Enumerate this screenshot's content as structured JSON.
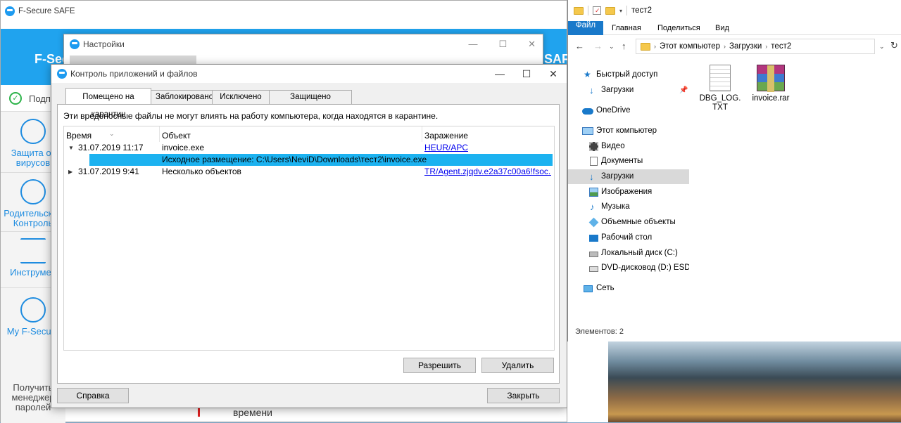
{
  "fsafe": {
    "title": "F-Secure SAFE",
    "brand_left": "F-Sec",
    "brand_right": "SAFE",
    "status_text": "Подпи",
    "sidebar": [
      {
        "label": "Защита от вирусов"
      },
      {
        "label": "Родительский Контроль"
      },
      {
        "label": "Инструмен"
      },
      {
        "label": "My F-Secure"
      }
    ],
    "sidebar_bottom": "Получить менеджер паролей",
    "bottom_word": "времени"
  },
  "settings": {
    "title": "Настройки"
  },
  "dialog": {
    "title": "Контроль приложений и файлов",
    "tabs": [
      "Помещено на карантин",
      "Заблокировано",
      "Исключено",
      "Защищено"
    ],
    "description": "Эти вредоносные файлы не могут влиять на работу компьютера, когда находятся в карантине.",
    "columns": [
      "Время",
      "Объект",
      "Заражение"
    ],
    "rows": [
      {
        "time": "31.07.2019 11:17",
        "object": "invoice.exe",
        "infection": "HEUR/APC"
      },
      {
        "detail": "Исходное размещение: C:\\Users\\NeviD\\Downloads\\тест2\\invoice.exe"
      },
      {
        "time": "31.07.2019 9:41",
        "object": "Несколько объектов",
        "infection": "TR/Agent.zjqdv.e2a37c00a6!fsoc..."
      }
    ],
    "buttons": {
      "allow": "Разрешить",
      "delete": "Удалить",
      "help": "Справка",
      "close": "Закрыть"
    }
  },
  "explorer": {
    "title": "тест2",
    "ribbon": [
      "Файл",
      "Главная",
      "Поделиться",
      "Вид"
    ],
    "breadcrumb": [
      "Этот компьютер",
      "Загрузки",
      "тест2"
    ],
    "nav": [
      {
        "label": "Быстрый доступ",
        "icon": "star-icon"
      },
      {
        "label": "Загрузки",
        "icon": "download-icon"
      },
      {
        "label": "OneDrive",
        "icon": "cloud-icon"
      },
      {
        "label": "Этот компьютер",
        "icon": "computer-icon"
      },
      {
        "label": "Видео",
        "icon": "video-icon"
      },
      {
        "label": "Документы",
        "icon": "document-icon"
      },
      {
        "label": "Загрузки",
        "icon": "download-icon"
      },
      {
        "label": "Изображения",
        "icon": "image-icon"
      },
      {
        "label": "Музыка",
        "icon": "music-icon"
      },
      {
        "label": "Объемные объекты",
        "icon": "cube-icon"
      },
      {
        "label": "Рабочий стол",
        "icon": "desktop-icon"
      },
      {
        "label": "Локальный диск (C:)",
        "icon": "drive-icon"
      },
      {
        "label": "DVD-дисковод (D:) ESD-IS",
        "icon": "dvd-icon"
      },
      {
        "label": "Сеть",
        "icon": "network-icon"
      }
    ],
    "files": [
      {
        "name": "DBG_LOG.TXT",
        "icon": "text-file-icon"
      },
      {
        "name": "invoice.rar",
        "icon": "rar-archive-icon"
      }
    ],
    "status": "Элементов: 2"
  },
  "colors": {
    "fsecure_blue": "#20a3ee",
    "selection": "#1cb2f0",
    "explorer_file_tab": "#1979ca"
  }
}
